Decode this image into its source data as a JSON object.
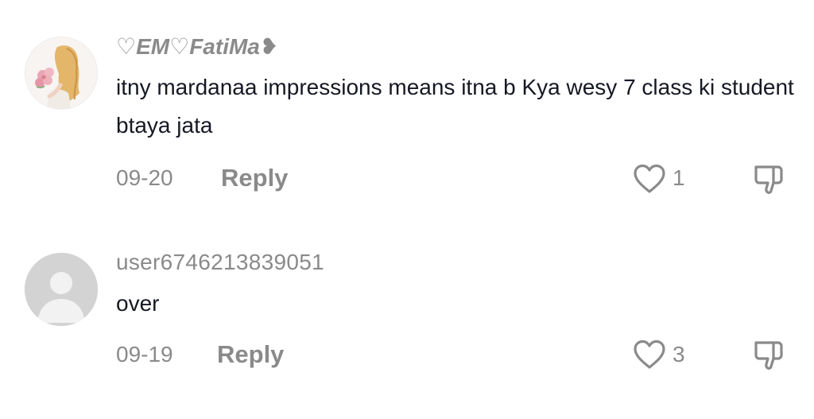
{
  "comments": [
    {
      "username": "♡EM♡FatiMa❥",
      "text": "itny mardanaa impressions means itna b Kya wesy 7 class ki student btaya jata",
      "date": "09-20",
      "reply_label": "Reply",
      "like_count": "1",
      "avatar": "profile-photo-girl-with-flowers"
    },
    {
      "username": "user6746213839051",
      "text": "over",
      "date": "09-19",
      "reply_label": "Reply",
      "like_count": "3",
      "avatar": "default-avatar-icon"
    }
  ],
  "colors": {
    "text_primary": "#161823",
    "text_secondary": "#8a8a8a",
    "default_avatar_bg": "#d3d3d3",
    "icon_stroke": "#8a8a8a"
  }
}
